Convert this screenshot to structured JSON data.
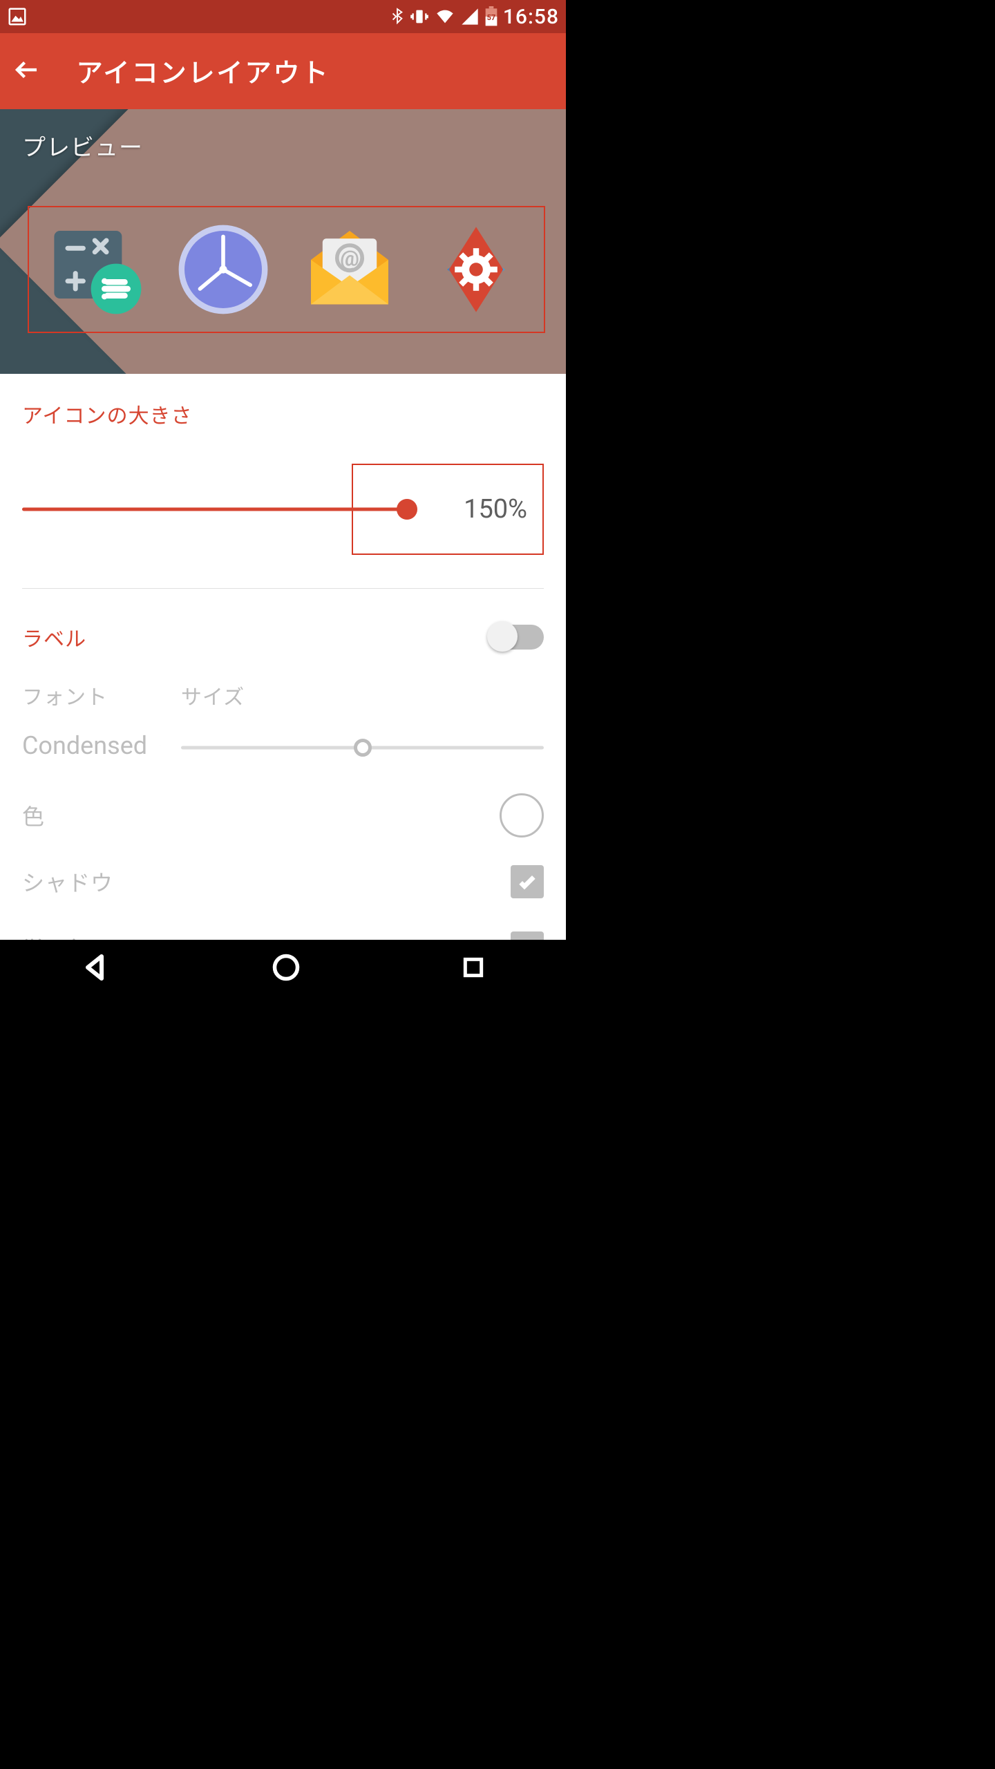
{
  "status": {
    "time": "16:58",
    "battery": "57"
  },
  "header": {
    "title": "アイコンレイアウト"
  },
  "preview": {
    "label": "プレビュー"
  },
  "icon_size": {
    "title": "アイコンの大きさ",
    "value_text": "150%",
    "percent": 150,
    "slider_min": 50,
    "slider_max": 150
  },
  "label_section": {
    "title": "ラベル",
    "enabled": false,
    "font_label": "フォント",
    "size_label": "サイズ",
    "font_value": "Condensed",
    "size_percent": 50,
    "color_label": "色",
    "shadow_label": "シャドウ",
    "shadow_checked": true,
    "single_line_label": "単一行",
    "single_line_checked": true
  },
  "icons": {
    "calc": "calculator-icon",
    "clock": "clock-icon",
    "mail": "email-icon",
    "settings": "nova-settings-icon"
  }
}
